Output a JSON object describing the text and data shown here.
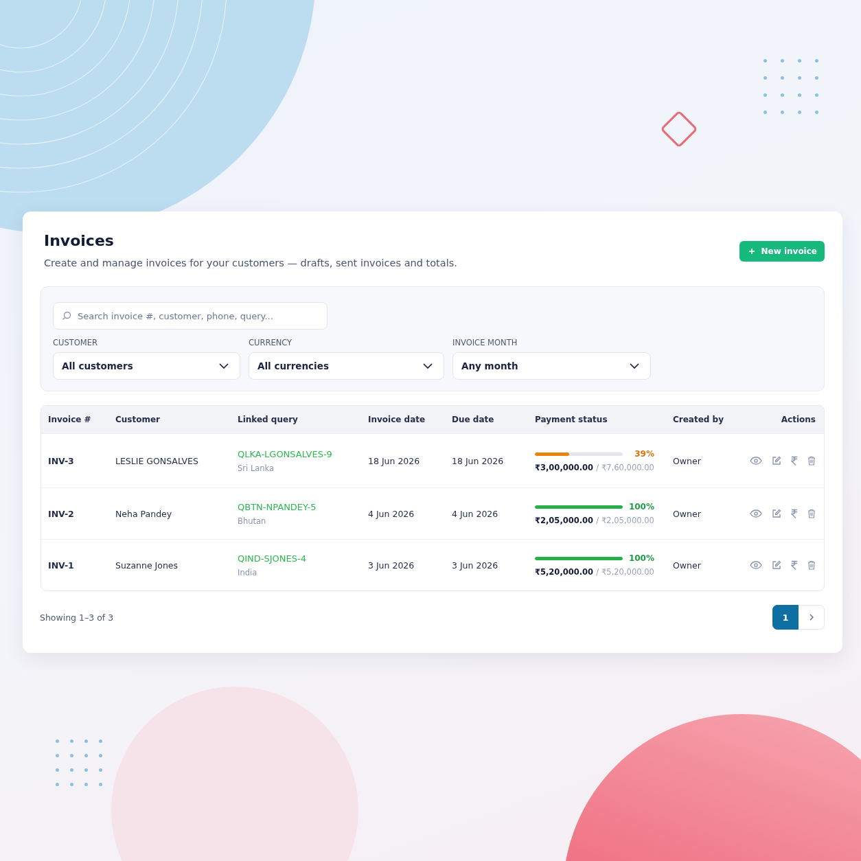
{
  "header": {
    "title": "Invoices",
    "subtitle": "Create and manage invoices for your customers — drafts, sent invoices and totals.",
    "new_button": "New invoice"
  },
  "filters": {
    "search": {
      "placeholder": "Search invoice #, customer, phone, query..."
    },
    "selects": [
      {
        "label": "CUSTOMER",
        "value": "All customers"
      },
      {
        "label": "CURRENCY",
        "value": "All currencies"
      },
      {
        "label": "INVOICE MONTH",
        "value": "Any month"
      }
    ]
  },
  "table": {
    "columns": [
      "Invoice #",
      "Customer",
      "Linked query",
      "Invoice date",
      "Due date",
      "Payment status",
      "Created by",
      "Actions"
    ],
    "rows": [
      {
        "invoice": "INV-3",
        "customer": "LESLIE GONSALVES",
        "query": "QLKA-LGONSALVES-9",
        "country": "Sri Lanka",
        "invoice_date": "18 Jun 2026",
        "due_date": "18 Jun 2026",
        "kind": "partial",
        "level": 0.39,
        "percent": "39%",
        "paid": "₹3,00,000.00",
        "separator": "/",
        "total": "₹7,60,000.00",
        "created_by": "Owner"
      },
      {
        "invoice": "INV-2",
        "customer": "Neha Pandey",
        "query": "QBTN-NPANDEY-5",
        "country": "Bhutan",
        "invoice_date": "4 Jun 2026",
        "due_date": "4 Jun 2026",
        "kind": "paid",
        "level": 1,
        "percent": "100%",
        "paid": "₹2,05,000.00",
        "separator": "/",
        "total": "₹2,05,000.00",
        "created_by": "Owner"
      },
      {
        "invoice": "INV-1",
        "customer": "Suzanne Jones",
        "query": "QIND-SJONES-4",
        "country": "India",
        "invoice_date": "3 Jun 2026",
        "due_date": "3 Jun 2026",
        "kind": "paid",
        "level": 1,
        "percent": "100%",
        "paid": "₹5,20,000.00",
        "separator": "/",
        "total": "₹5,20,000.00",
        "created_by": "Owner"
      }
    ]
  },
  "footer": {
    "showing": "Showing 1–3 of 3",
    "pages": [
      {
        "label": "1",
        "selected": true
      }
    ]
  }
}
